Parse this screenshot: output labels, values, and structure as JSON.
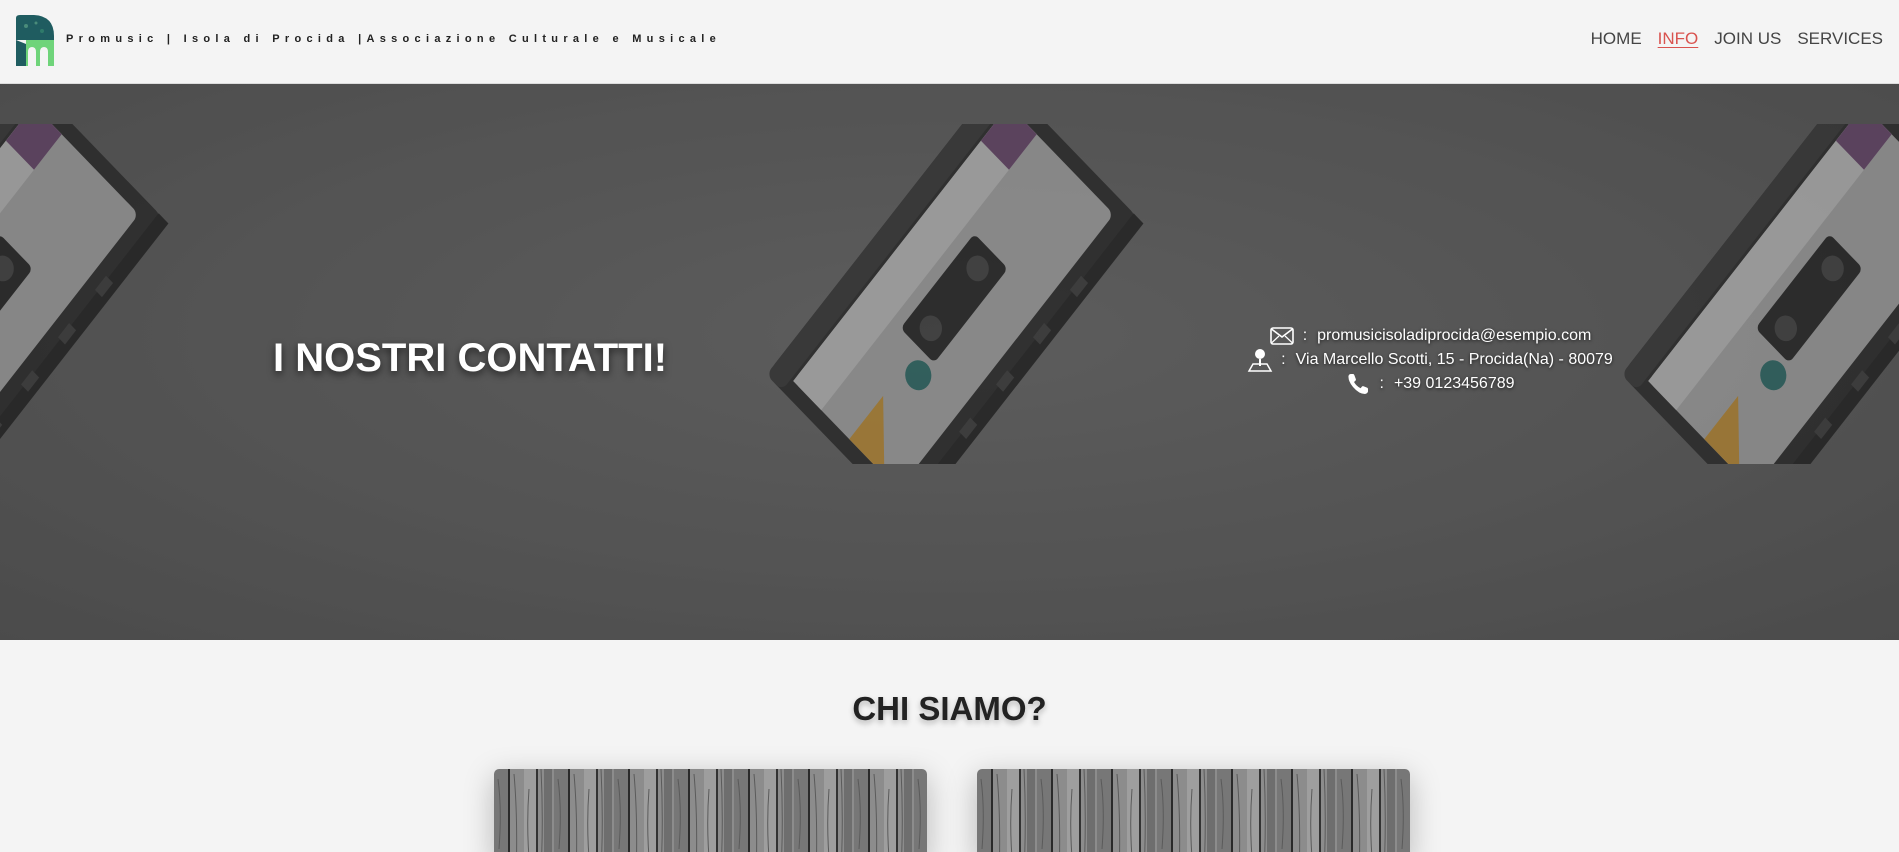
{
  "header": {
    "brand": "Promusic | Isola di Procida |Associazione Culturale e Musicale",
    "logo_icon": "promusic-logo-icon",
    "nav": [
      {
        "label": "HOME",
        "active": false
      },
      {
        "label": "INFO",
        "active": true
      },
      {
        "label": "JOIN US",
        "active": false
      },
      {
        "label": "SERVICES",
        "active": false
      }
    ]
  },
  "hero": {
    "title": "I NOSTRI CONTATTI!",
    "contacts": [
      {
        "icon": "mail-icon",
        "separator": ":",
        "text": "promusicisoladiprocida@esempio.com"
      },
      {
        "icon": "map-pin-icon",
        "separator": ":",
        "text": "Via Marcello Scotti, 15 - Procida(Na) - 80079"
      },
      {
        "icon": "phone-icon",
        "separator": ":",
        "text": "+39 0123456789"
      }
    ]
  },
  "about": {
    "title": "CHI SIAMO?"
  },
  "colors": {
    "accent": "#d9534f",
    "logo_teal": "#1f5c60",
    "logo_green": "#6fd47a"
  }
}
